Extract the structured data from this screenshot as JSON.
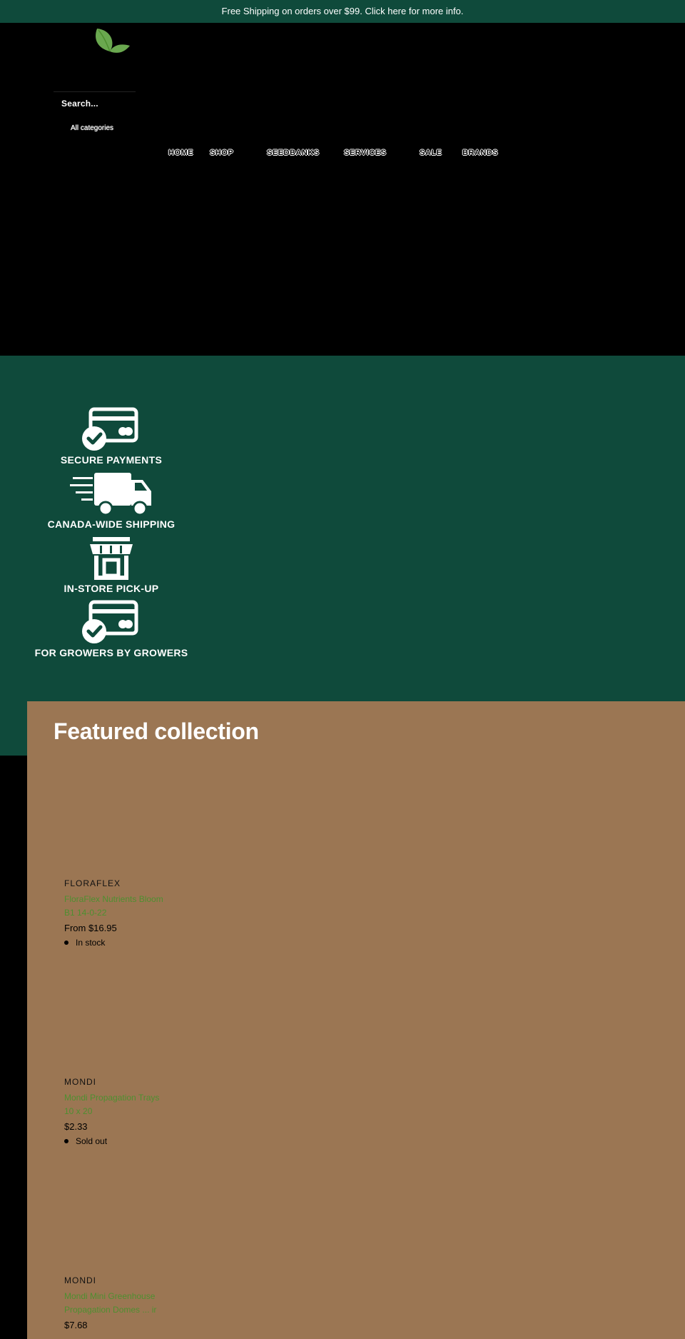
{
  "announcement": "Free Shipping on orders over $99. Click here for more info.",
  "header": {
    "search_placeholder": "Search...",
    "category_select": "All categories"
  },
  "nav": [
    "HOME",
    "SHOP",
    "SEEDBANKS",
    "SERVICES",
    "SALE",
    "BRANDS"
  ],
  "colors": {
    "brand_green": "#0f4a3b",
    "featured_bg": "#9b7653",
    "title_link": "#4e8f30",
    "leaf": "#6aa84f"
  },
  "features": [
    {
      "icon": "credit-card-check-icon",
      "label": "SECURE PAYMENTS"
    },
    {
      "icon": "delivery-truck-icon",
      "label": "CANADA-WIDE SHIPPING"
    },
    {
      "icon": "storefront-icon",
      "label": "IN-STORE PICK-UP"
    },
    {
      "icon": "credit-card-check-icon",
      "label": "FOR GROWERS BY GROWERS"
    }
  ],
  "featured": {
    "title": "Featured collection",
    "products": [
      {
        "vendor": "FLORAFLEX",
        "title": "FloraFlex Nutrients Bloom B1 14-0-22",
        "price": "From $16.95",
        "stock": "In stock"
      },
      {
        "vendor": "MONDI",
        "title": "Mondi Propagation Trays 10 x 20",
        "price": "$2.33",
        "stock": "Sold out"
      },
      {
        "vendor": "MONDI",
        "title": "Mondi Mini Greenhouse Propagation Domes ... ir",
        "price": "$7.68",
        "stock": ""
      }
    ]
  }
}
